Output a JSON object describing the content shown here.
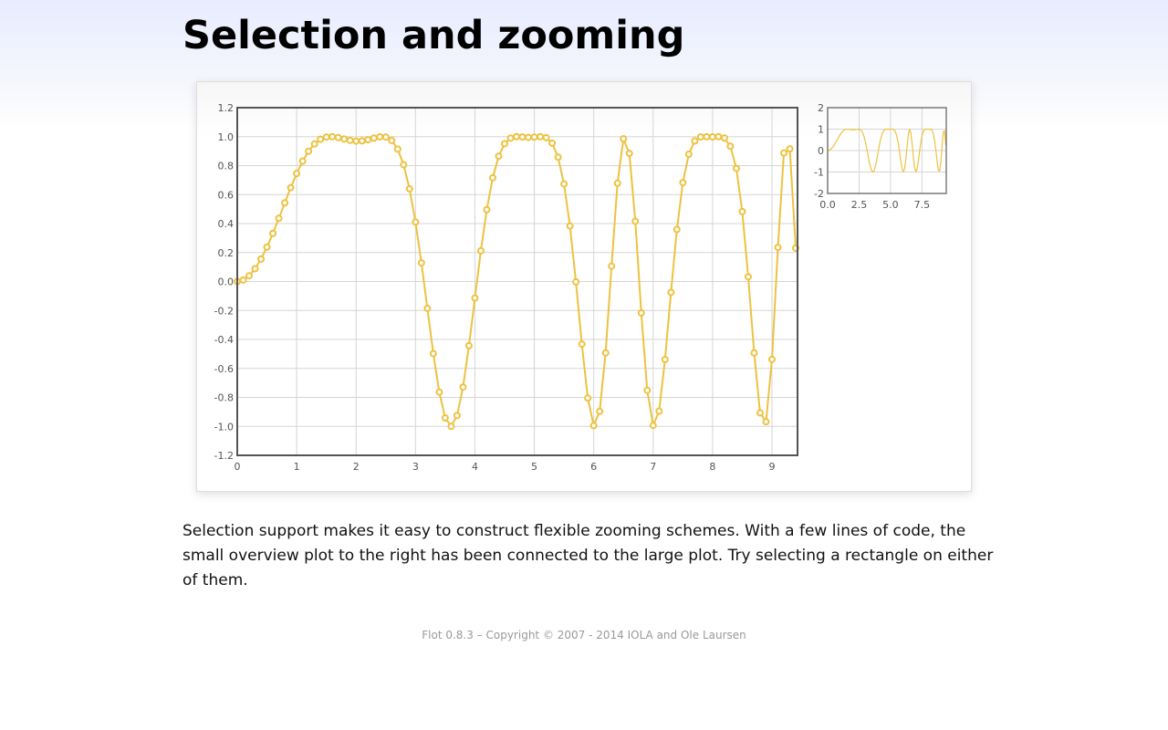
{
  "page": {
    "title": "Selection and zooming",
    "description": "Selection support makes it easy to construct flexible zooming schemes. With a few lines of code, the small overview plot to the right has been connected to the large plot. Try selecting a rectangle on either of them.",
    "footer": "Flot 0.8.3 – Copyright © 2007 - 2014 IOLA and Ole Laursen"
  },
  "colors": {
    "series": "#edc240",
    "grid": "#d5d5d5",
    "axis_border": "#545454",
    "tick_text": "#545454"
  },
  "chart_data": [
    {
      "id": "main",
      "type": "line",
      "function": "sin(x * sin(x))",
      "x_range": [
        0,
        9.43
      ],
      "step": 0.1,
      "points_shown": true,
      "xlim": [
        0,
        9.43
      ],
      "ylim": [
        -1.2,
        1.2
      ],
      "x_ticks": [
        0,
        1,
        2,
        3,
        4,
        5,
        6,
        7,
        8,
        9
      ],
      "x_tick_labels": [
        "0",
        "1",
        "2",
        "3",
        "4",
        "5",
        "6",
        "7",
        "8",
        "9"
      ],
      "y_ticks": [
        -1.2,
        -1.0,
        -0.8,
        -0.6,
        -0.4,
        -0.2,
        0.0,
        0.2,
        0.4,
        0.6,
        0.8,
        1.0,
        1.2
      ],
      "y_tick_labels": [
        "-1.2",
        "-1.0",
        "-0.8",
        "-0.6",
        "-0.4",
        "-0.2",
        "0.0",
        "0.2",
        "0.4",
        "0.6",
        "0.8",
        "1.0",
        "1.2"
      ],
      "grid": true,
      "legend": "none"
    },
    {
      "id": "overview",
      "type": "line",
      "function": "sin(x * sin(x))",
      "x_range": [
        0,
        9.43
      ],
      "step": 0.1,
      "points_shown": false,
      "xlim": [
        0,
        9.43
      ],
      "ylim": [
        -2,
        2
      ],
      "x_ticks": [
        0,
        2.5,
        5,
        7.5
      ],
      "x_tick_labels": [
        "0.0",
        "2.5",
        "5.0",
        "7.5"
      ],
      "y_ticks": [
        -2,
        -1,
        0,
        1,
        2
      ],
      "y_tick_labels": [
        "-2",
        "-1",
        "0",
        "1",
        "2"
      ],
      "grid": true,
      "legend": "none"
    }
  ]
}
